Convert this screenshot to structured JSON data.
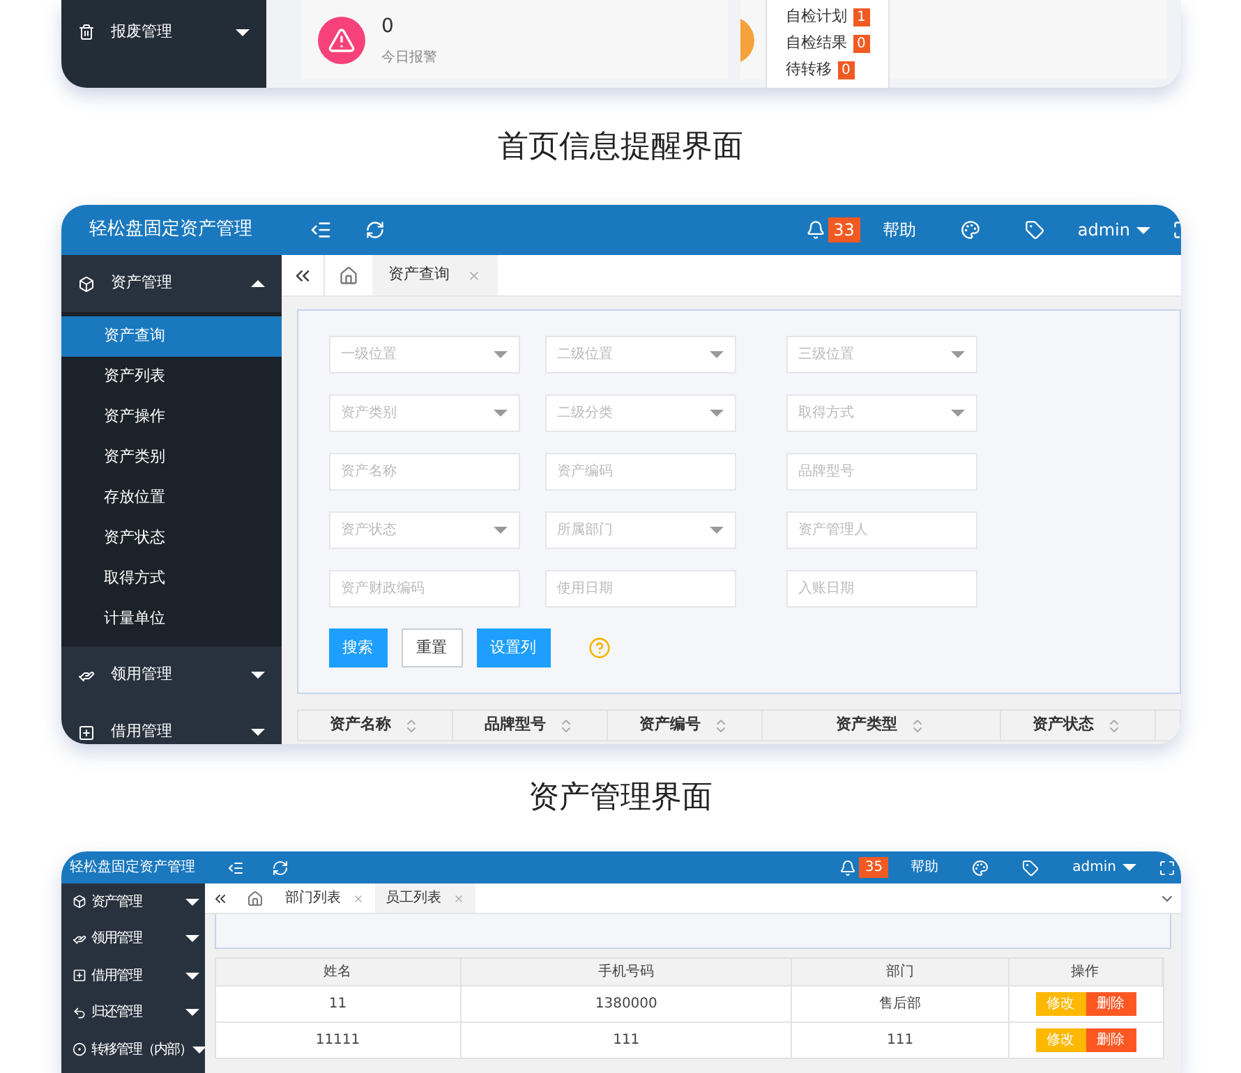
{
  "dashboard_preview": {
    "sidebar_items": [
      {
        "label": "报废管理",
        "expanded": false
      }
    ],
    "alert_card": {
      "value": "0",
      "label": "今日报警"
    },
    "dropdown_items": [
      {
        "label": "自检计划",
        "count": "1"
      },
      {
        "label": "自检结果",
        "count": "0"
      },
      {
        "label": "待转移",
        "count": "0"
      }
    ]
  },
  "caption_1": "首页信息提醒界面",
  "asset_preview": {
    "header": {
      "brand": "轻松盘固定资产管理",
      "notification_count": "33",
      "help": "帮助",
      "user": "admin"
    },
    "sidebar": [
      {
        "label": "资产管理",
        "expanded": true,
        "children": [
          {
            "label": "资产查询",
            "selected": true
          },
          {
            "label": "资产列表",
            "selected": false
          },
          {
            "label": "资产操作",
            "selected": false
          },
          {
            "label": "资产类别",
            "selected": false
          },
          {
            "label": "存放位置",
            "selected": false
          },
          {
            "label": "资产状态",
            "selected": false
          },
          {
            "label": "取得方式",
            "selected": false
          },
          {
            "label": "计量单位",
            "selected": false
          }
        ]
      },
      {
        "label": "领用管理",
        "expanded": false
      },
      {
        "label": "借用管理",
        "expanded": false
      }
    ],
    "tabs": [
      {
        "label": "资产查询",
        "selected": true
      }
    ],
    "filters": [
      {
        "placeholder": "一级位置",
        "kind": "select"
      },
      {
        "placeholder": "二级位置",
        "kind": "select"
      },
      {
        "placeholder": "三级位置",
        "kind": "select"
      },
      {
        "placeholder": "资产类别",
        "kind": "select"
      },
      {
        "placeholder": "二级分类",
        "kind": "select"
      },
      {
        "placeholder": "取得方式",
        "kind": "select"
      },
      {
        "placeholder": "资产名称",
        "kind": "input"
      },
      {
        "placeholder": "资产编码",
        "kind": "input"
      },
      {
        "placeholder": "品牌型号",
        "kind": "input"
      },
      {
        "placeholder": "资产状态",
        "kind": "select"
      },
      {
        "placeholder": "所属部门",
        "kind": "select"
      },
      {
        "placeholder": "资产管理人",
        "kind": "input"
      },
      {
        "placeholder": "资产财政编码",
        "kind": "input"
      },
      {
        "placeholder": "使用日期",
        "kind": "input"
      },
      {
        "placeholder": "入账日期",
        "kind": "input"
      }
    ],
    "buttons": [
      {
        "label": "搜索",
        "kind": "primary"
      },
      {
        "label": "重置",
        "kind": "default"
      },
      {
        "label": "设置列",
        "kind": "primary"
      }
    ],
    "table_columns": [
      "资产名称",
      "品牌型号",
      "资产编号",
      "资产类型",
      "资产状态"
    ]
  },
  "caption_2": "资产管理界面",
  "staff_preview": {
    "header": {
      "brand": "轻松盘固定资产管理",
      "notification_count": "35",
      "help": "帮助",
      "user": "admin"
    },
    "sidebar": [
      {
        "label": "资产管理",
        "expanded": false
      },
      {
        "label": "领用管理",
        "expanded": false
      },
      {
        "label": "借用管理",
        "expanded": false
      },
      {
        "label": "归还管理",
        "expanded": false
      },
      {
        "label": "转移管理（内部）",
        "expanded": false
      }
    ],
    "tabs": [
      {
        "label": "部门列表",
        "selected": false
      },
      {
        "label": "员工列表",
        "selected": true
      }
    ],
    "table_columns": [
      "姓名",
      "手机号码",
      "部门",
      "操作"
    ],
    "rows": [
      {
        "cells": [
          "11",
          "1380000",
          "售后部"
        ],
        "actions": [
          "修改",
          "删除"
        ]
      },
      {
        "cells": [
          "11111",
          "111",
          "111"
        ],
        "actions": [
          "修改",
          "删除"
        ]
      }
    ]
  }
}
